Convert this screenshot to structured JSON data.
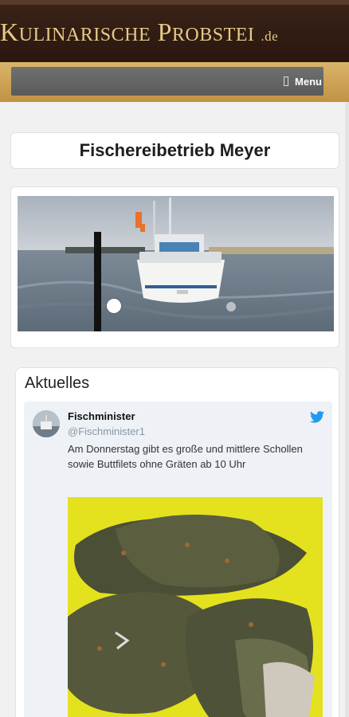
{
  "header": {
    "logo_main_1": "K",
    "logo_small_1": "ULINARISCHE",
    "logo_main_2": "P",
    "logo_small_2": "ROBSTEI",
    "logo_tld": ".de"
  },
  "nav": {
    "menu_label": "Menu",
    "menu_icon": "hamburger-icon"
  },
  "page": {
    "title": "Fischereibetrieb Meyer"
  },
  "news": {
    "heading": "Aktuelles",
    "tweet": {
      "name": "Fischminister",
      "handle": "@Fischminister1",
      "text": "Am Donnerstag gibt es große und mittlere Schollen sowie Buttfilets ohne Gräten ab 10 Uhr",
      "icon": "twitter-bird-icon"
    }
  },
  "colors": {
    "header_bg": "#2a1710",
    "logo_gold": "#e7c986",
    "menubar_gold": "#c19243",
    "twitter_blue": "#1d9bf0",
    "fish_bg_yellow": "#e4e21f"
  }
}
